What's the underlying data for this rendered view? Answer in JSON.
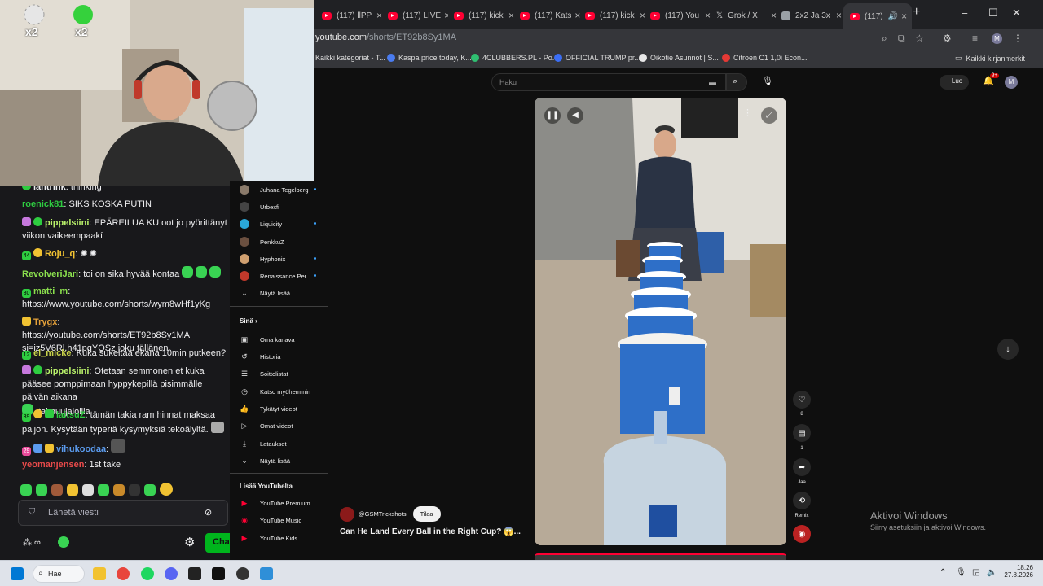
{
  "browser": {
    "tabs": [
      {
        "label": "(117) llPP"
      },
      {
        "label": "(117) LIVE"
      },
      {
        "label": "(117) kick"
      },
      {
        "label": "(117) Kats"
      },
      {
        "label": "(117) kick"
      },
      {
        "label": "(117) You"
      },
      {
        "label": "Grok / X"
      },
      {
        "label": "2x2 Ja 3x"
      },
      {
        "label": "(117)"
      }
    ],
    "new_tab": "+",
    "url_host": "youtube.com",
    "url_path": "/shorts/ET92b8Sy1MA",
    "bookmarks": [
      {
        "label": "Kaikki kategoriat - T...",
        "color": "#f5a623"
      },
      {
        "label": "Kaspa price today, K...",
        "color": "#4a7cf0"
      },
      {
        "label": "4CLUBBERS.PL - Po...",
        "color": "#2fbf71"
      },
      {
        "label": "OFFICIAL TRUMP pr...",
        "color": "#3b6ef5"
      },
      {
        "label": "Oikotie Asunnot | S...",
        "color": "#e8e8e8"
      },
      {
        "label": "Citroen C1 1,0i Econ...",
        "color": "#e53935"
      }
    ],
    "all_bookmarks": "Kaikki kirjanmerkit",
    "profile_initial": "M"
  },
  "webcam": {
    "overlay_left": "x2",
    "overlay_right": "x2"
  },
  "chat": {
    "messages": [
      {
        "user": "lahtrink",
        "user_color": "#efeff1",
        "text": "thinking"
      },
      {
        "user": "roenick81",
        "user_color": "#2ecc40",
        "text": "SIKS KOSKA PUTIN"
      },
      {
        "user": "pippelsiini",
        "user_color": "#b9f16a",
        "text": "EPÄREILUA KU oot jo pyörittänyt viikon vaikeempaakí"
      },
      {
        "user": "Roju_q",
        "user_color": "#f1c232",
        "badge_num": "44",
        "text": ""
      },
      {
        "user": "RevolveriJari",
        "user_color": "#8be04e",
        "text": "toi on sika hyvää kontaa"
      },
      {
        "user": "matti_m",
        "user_color": "#8be04e",
        "badge_num": "30",
        "text": "",
        "link": "https://www.youtube.com/shorts/wym8wHf1yKg"
      },
      {
        "user": "Trygx",
        "user_color": "#e5a13a",
        "link1": "https://youtube.com/shorts/ET92b8Sy1MA",
        "link2": "si=iz5V6Rl.h41pqYOSz",
        "text": "joku tällänen"
      },
      {
        "user": "el_micke",
        "user_color": "#c9d34a",
        "badge_num": "12",
        "text": "Kuka sukeltaa ekana 10min putkeen?"
      },
      {
        "user": "pippelsiini",
        "user_color": "#b9f16a",
        "text": "Otetaan semmonen et kuka pääsee pomppimaan hyppykepillä pisimmälle päivän aikana",
        "text2": "tai puujaloilla"
      },
      {
        "user": "laitsuZ",
        "user_color": "#2ecc40",
        "badge_num": "39",
        "text": "tämän takia ram hinnat maksaa paljon. Kysytään typeriä kysymyksiä tekoälyltä."
      },
      {
        "user": "vihukoodaa",
        "user_color": "#5b9cf0",
        "badge_num": "29",
        "text": ""
      },
      {
        "user": "yeomanjensen",
        "user_color": "#e84a4a",
        "text": "1st take"
      }
    ],
    "input_placeholder": "Lähetä viesti",
    "chat_button": "Cha"
  },
  "sidebar": {
    "subscriptions": [
      {
        "label": "Juhana Tegelberg",
        "color": "#8a7a6a",
        "new": true
      },
      {
        "label": "Urbexfi",
        "color": "#444",
        "new": false
      },
      {
        "label": "Liquicity",
        "color": "#2aa7d8",
        "new": true
      },
      {
        "label": "PenkkuZ",
        "color": "#6b5040",
        "new": false
      },
      {
        "label": "Hyphonix",
        "color": "#d0a070",
        "new": true
      },
      {
        "label": "Renaissance Per...",
        "color": "#c0392b",
        "new": true
      }
    ],
    "show_more_1": "Näytä lisää",
    "you_header": "Sinä",
    "you_items": [
      {
        "label": "Oma kanava",
        "icon": "channel-icon"
      },
      {
        "label": "Historia",
        "icon": "history-icon"
      },
      {
        "label": "Soittolistat",
        "icon": "playlists-icon"
      },
      {
        "label": "Katso myöhemmin",
        "icon": "watch-later-icon"
      },
      {
        "label": "Tykätyt videot",
        "icon": "liked-icon"
      },
      {
        "label": "Omat videot",
        "icon": "your-videos-icon"
      },
      {
        "label": "Lataukset",
        "icon": "downloads-icon"
      }
    ],
    "show_more_2": "Näytä lisää",
    "more_header": "Lisää YouTubelta",
    "more_items": [
      {
        "label": "YouTube Premium"
      },
      {
        "label": "YouTube Music"
      },
      {
        "label": "YouTube Kids"
      }
    ]
  },
  "youtube": {
    "search_placeholder": "Haku",
    "create_label": "Luo",
    "notif_badge": "9+",
    "avatar_initial": "M",
    "likes": "8",
    "comments": "1",
    "share_label": "Jaa",
    "remix_label": "Remix",
    "channel": "@GSMTrickshots",
    "subscribe": "Tilaa",
    "title": "Can He Land Every Ball in the Right Cup? 😱...",
    "activate_title": "Aktivoi Windows",
    "activate_sub": "Siirry asetuksiin ja aktivoi Windows."
  },
  "taskbar": {
    "search": "Hae",
    "time": "18.26",
    "date": "27.8.2026"
  }
}
